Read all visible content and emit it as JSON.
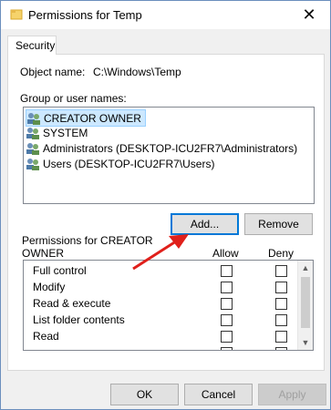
{
  "window": {
    "title": "Permissions for Temp",
    "close": "✕"
  },
  "tabs": [
    {
      "label": "Security"
    }
  ],
  "object": {
    "label": "Object name:",
    "value": "C:\\Windows\\Temp"
  },
  "groups": {
    "label": "Group or user names:",
    "items": [
      {
        "label": "CREATOR OWNER",
        "selected": true
      },
      {
        "label": "SYSTEM"
      },
      {
        "label": "Administrators (DESKTOP-ICU2FR7\\Administrators)"
      },
      {
        "label": "Users (DESKTOP-ICU2FR7\\Users)"
      }
    ]
  },
  "buttons": {
    "add": "Add...",
    "remove": "Remove",
    "ok": "OK",
    "cancel": "Cancel",
    "apply": "Apply"
  },
  "permissions": {
    "label_line1": "Permissions for CREATOR",
    "label_line2": "OWNER",
    "allow": "Allow",
    "deny": "Deny",
    "rows": [
      {
        "name": "Full control",
        "allow": false,
        "deny": false
      },
      {
        "name": "Modify",
        "allow": false,
        "deny": false
      },
      {
        "name": "Read & execute",
        "allow": false,
        "deny": false
      },
      {
        "name": "List folder contents",
        "allow": false,
        "deny": false
      },
      {
        "name": "Read",
        "allow": false,
        "deny": false
      }
    ]
  },
  "colors": {
    "accent": "#0078d7",
    "arrow": "#e0201b",
    "selection": "#cce8ff"
  }
}
